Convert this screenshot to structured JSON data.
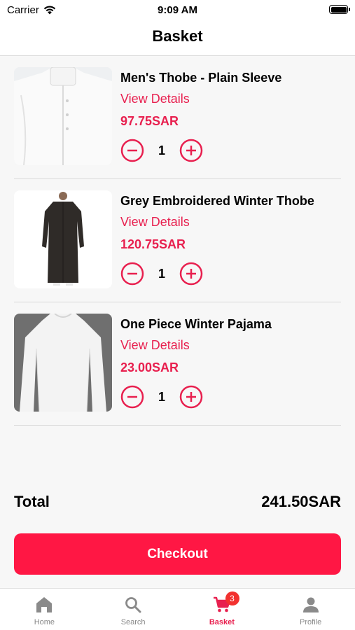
{
  "status": {
    "carrier": "Carrier",
    "time": "9:09 AM"
  },
  "header": {
    "title": "Basket"
  },
  "accent_color": "#e8204f",
  "items": [
    {
      "name": "Men's Thobe - Plain Sleeve",
      "details_label": "View Details",
      "price": "97.75SAR",
      "quantity": "1"
    },
    {
      "name": "Grey Embroidered Winter Thobe",
      "details_label": "View Details",
      "price": "120.75SAR",
      "quantity": "1"
    },
    {
      "name": "One Piece Winter Pajama",
      "details_label": "View Details",
      "price": "23.00SAR",
      "quantity": "1"
    }
  ],
  "summary": {
    "total_label": "Total",
    "total_value": "241.50SAR"
  },
  "checkout_label": "Checkout",
  "tabs": [
    {
      "label": "Home",
      "icon": "home-icon"
    },
    {
      "label": "Search",
      "icon": "search-icon"
    },
    {
      "label": "Basket",
      "icon": "cart-icon",
      "badge": "3",
      "active": true
    },
    {
      "label": "Profile",
      "icon": "person-icon"
    }
  ]
}
